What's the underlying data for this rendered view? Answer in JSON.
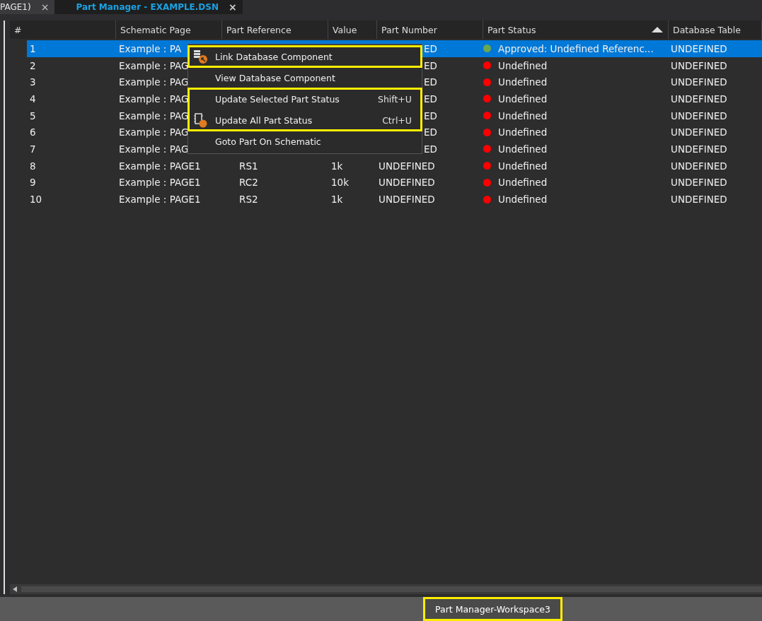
{
  "tabs": [
    {
      "label": "PAGE1)",
      "close": "×",
      "selected": false
    },
    {
      "label": "Part Manager - EXAMPLE.DSN",
      "close": "×",
      "selected": true
    }
  ],
  "table": {
    "columns": [
      {
        "label": "#",
        "sorted": false
      },
      {
        "label": "Schematic Page",
        "sorted": false
      },
      {
        "label": "Part Reference",
        "sorted": false
      },
      {
        "label": "Value",
        "sorted": false
      },
      {
        "label": "Part Number",
        "sorted": false
      },
      {
        "label": "Part Status",
        "sorted": true
      },
      {
        "label": "Database Table",
        "sorted": false
      }
    ],
    "rows": [
      {
        "num": "1",
        "page": "Example : PA",
        "part_number": "ED",
        "status": "Approved: Undefined Referenc...",
        "color": "#6aa84f",
        "table": "UNDEFINED",
        "selected": true
      },
      {
        "num": "2",
        "page": "Example : PAG",
        "part_number": "ED",
        "status": "Undefined",
        "color": "#ff0000",
        "table": "UNDEFINED",
        "selected": false
      },
      {
        "num": "3",
        "page": "Example : PAG",
        "part_number": "ED",
        "status": "Undefined",
        "color": "#ff0000",
        "table": "UNDEFINED",
        "selected": false
      },
      {
        "num": "4",
        "page": "Example : PAG",
        "part_number": "ED",
        "status": "Undefined",
        "color": "#ff0000",
        "table": "UNDEFINED",
        "selected": false
      },
      {
        "num": "5",
        "page": "Example : PAG",
        "part_number": "ED",
        "status": "Undefined",
        "color": "#ff0000",
        "table": "UNDEFINED",
        "selected": false
      },
      {
        "num": "6",
        "page": "Example : PAG",
        "part_number": "ED",
        "status": "Undefined",
        "color": "#ff0000",
        "table": "UNDEFINED",
        "selected": false
      },
      {
        "num": "7",
        "page": "Example : PAG",
        "part_number": "ED",
        "status": "Undefined",
        "color": "#ff0000",
        "table": "UNDEFINED",
        "selected": false
      },
      {
        "num": "8",
        "page": "Example : PAGE1",
        "reference": "RS1",
        "value": "1k",
        "part_number": "UNDEFINED",
        "status": "Undefined",
        "color": "#ff0000",
        "table": "UNDEFINED",
        "selected": false
      },
      {
        "num": "9",
        "page": "Example : PAGE1",
        "reference": "RC2",
        "value": "10k",
        "part_number": "UNDEFINED",
        "status": "Undefined",
        "color": "#ff0000",
        "table": "UNDEFINED",
        "selected": false
      },
      {
        "num": "10",
        "page": "Example : PAGE1",
        "reference": "RS2",
        "value": "1k",
        "part_number": "UNDEFINED",
        "status": "Undefined",
        "color": "#ff0000",
        "table": "UNDEFINED",
        "selected": false
      }
    ]
  },
  "context_menu": {
    "items": [
      {
        "label": "Link Database Component",
        "kind": "link",
        "highlighted": true
      },
      {
        "label": "View Database Component",
        "highlighted": false
      },
      {
        "label": "Update Selected Part Status",
        "shortcut": "Shift+U",
        "highlighted": true
      },
      {
        "label": "Update All Part Status",
        "shortcut": "Ctrl+U",
        "kind": "update",
        "highlighted": true
      },
      {
        "label": "Goto Part On Schematic",
        "highlighted": false
      }
    ]
  },
  "status_bar": {
    "label": "Part Manager-Workspace3",
    "highlighted": true
  }
}
